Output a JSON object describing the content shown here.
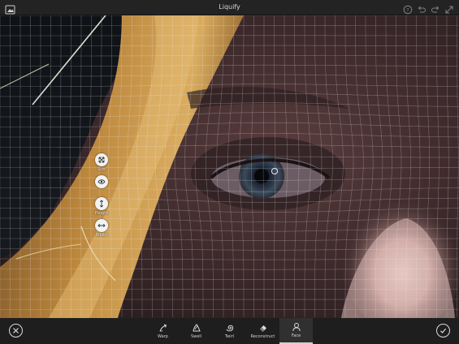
{
  "app": {
    "title": "Liquify"
  },
  "topbar": {
    "left_icon": "image-icon",
    "right_icons": [
      "help-icon",
      "undo-icon",
      "redo-icon",
      "fullscreen-icon"
    ]
  },
  "palette": {
    "items": [
      {
        "icon": "scale-icon",
        "label": "Size"
      },
      {
        "icon": "eye-icon",
        "label": ""
      },
      {
        "icon": "height-icon",
        "label": "Height"
      },
      {
        "icon": "width-icon",
        "label": "Width"
      }
    ]
  },
  "toolbar": {
    "cancel_icon": "close-icon",
    "confirm_icon": "check-icon",
    "tools": [
      {
        "icon": "warp-icon",
        "label": "Warp",
        "active": false
      },
      {
        "icon": "swell-icon",
        "label": "Swell",
        "active": false
      },
      {
        "icon": "twirl-icon",
        "label": "Twirl",
        "active": false
      },
      {
        "icon": "reconstruct-icon",
        "label": "Reconstruct",
        "active": false
      },
      {
        "icon": "face-icon",
        "label": "Face",
        "active": true
      }
    ]
  },
  "colors": {
    "chrome": "#232323",
    "bottombar": "#1e1e1e",
    "active_tool": "#303030",
    "icon": "#dcdcdc"
  }
}
